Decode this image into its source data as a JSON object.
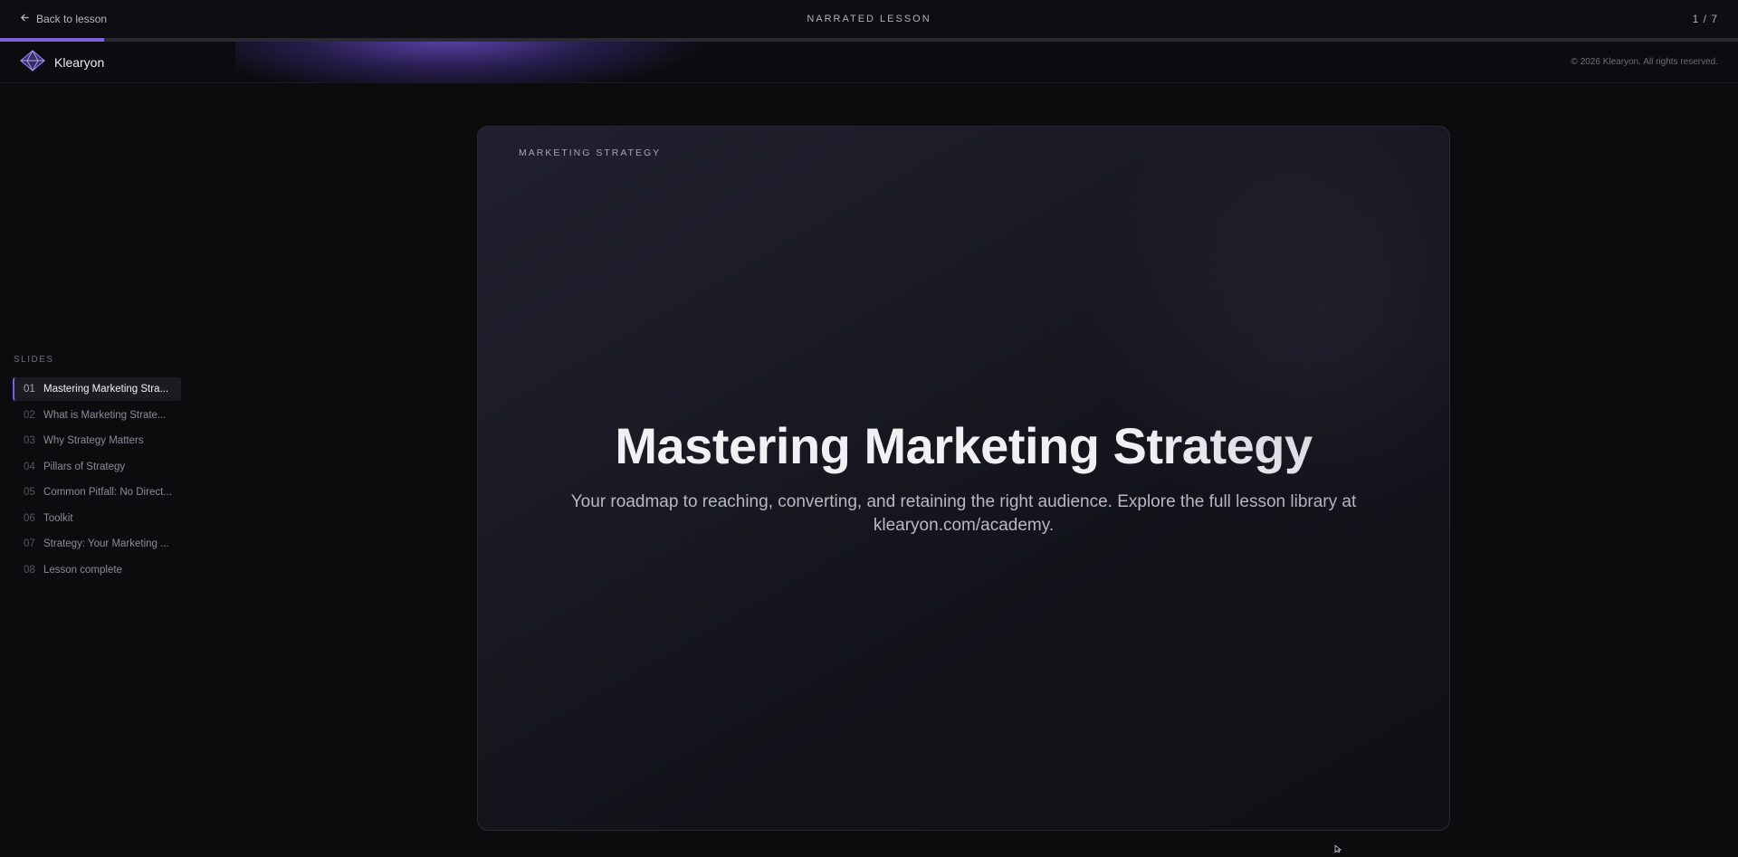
{
  "topbar": {
    "back_label": "Back to lesson",
    "title": "NARRATED LESSON",
    "counter": "1 / 7"
  },
  "progress": {
    "fraction": 0.06
  },
  "brand": {
    "name": "Klearyon",
    "copyright": "© 2026 Klearyon. All rights reserved."
  },
  "sidebar": {
    "heading": "SLIDES",
    "items": [
      {
        "num": "01",
        "label": "Mastering Marketing Stra...",
        "active": true
      },
      {
        "num": "02",
        "label": "What is Marketing Strate..."
      },
      {
        "num": "03",
        "label": "Why Strategy Matters"
      },
      {
        "num": "04",
        "label": "Pillars of Strategy"
      },
      {
        "num": "05",
        "label": "Common Pitfall: No Direct..."
      },
      {
        "num": "06",
        "label": "Toolkit"
      },
      {
        "num": "07",
        "label": "Strategy: Your Marketing ..."
      },
      {
        "num": "08",
        "label": "Lesson complete"
      }
    ]
  },
  "slide": {
    "eyebrow": "MARKETING STRATEGY",
    "title": "Mastering Marketing Strategy",
    "subtitle": "Your roadmap to reaching, converting, and retaining the right audience. Explore the full lesson library at klearyon.com/academy."
  },
  "colors": {
    "accent": "#7a63d9",
    "background": "#0c0c0f"
  }
}
